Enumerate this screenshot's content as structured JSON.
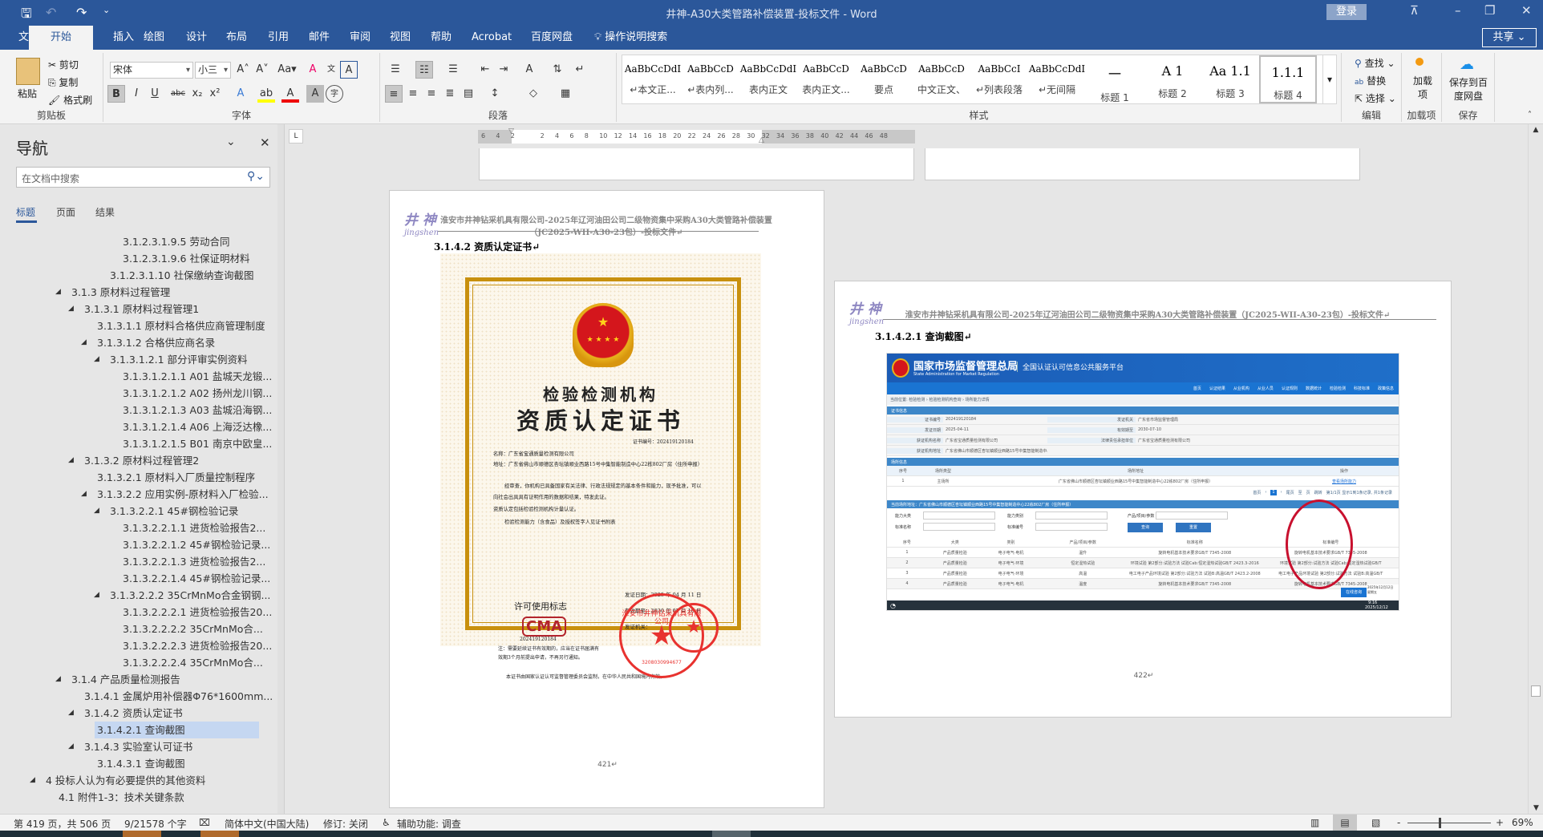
{
  "window": {
    "title": "井神-A30大类管路补偿装置-投标文件  -  Word",
    "login": "登录",
    "share": "共享"
  },
  "tabs": [
    "文件",
    "开始",
    "插入",
    "绘图",
    "设计",
    "布局",
    "引用",
    "邮件",
    "审阅",
    "视图",
    "帮助",
    "Acrobat",
    "百度网盘"
  ],
  "tell_me": "操作说明搜索",
  "ribbon": {
    "clipboard": {
      "paste": "粘贴",
      "cut": "剪切",
      "copy": "复制",
      "format_painter": "格式刷",
      "label": "剪贴板"
    },
    "font": {
      "name": "宋体",
      "size": "小三",
      "label": "字体"
    },
    "paragraph": {
      "label": "段落"
    },
    "styles": {
      "label": "样式",
      "items": [
        {
          "preview": "AaBbCcDdI",
          "name": "↵本文正..."
        },
        {
          "preview": "AaBbCcD",
          "name": "↵表内列..."
        },
        {
          "preview": "AaBbCcDdI",
          "name": "表内正文"
        },
        {
          "preview": "AaBbCcD",
          "name": "表内正文..."
        },
        {
          "preview": "AaBbCcD",
          "name": "要点"
        },
        {
          "preview": "AaBbCcD",
          "name": "中文正文、"
        },
        {
          "preview": "AaBbCcI",
          "name": "↵列表段落"
        },
        {
          "preview": "AaBbCcDdI",
          "name": "↵无间隔"
        },
        {
          "preview": "一",
          "name": "标题 1"
        },
        {
          "preview": "A 1",
          "name": "标题 2"
        },
        {
          "preview": "Aa 1.1",
          "name": "标题 3"
        },
        {
          "preview": "1.1.1",
          "name": "标题 4"
        }
      ]
    },
    "editing": {
      "find": "查找",
      "replace": "替换",
      "select": "选择",
      "label": "编辑"
    },
    "addins": {
      "button": "加载项",
      "label": "加载项"
    },
    "save": {
      "button": "保存到百度网盘",
      "label": "保存"
    }
  },
  "nav": {
    "title": "导航",
    "search_placeholder": "在文档中搜索",
    "tabs": [
      "标题",
      "页面",
      "结果"
    ],
    "items": [
      {
        "level": 7,
        "text": "3.1.2.3.1.9.5 劳动合同",
        "tri": ""
      },
      {
        "level": 7,
        "text": "3.1.2.3.1.9.6 社保证明材料",
        "tri": ""
      },
      {
        "level": 6,
        "text": "3.1.2.3.1.10 社保缴纳查询截图",
        "tri": ""
      },
      {
        "level": 3,
        "text": "3.1.3 原材料过程管理",
        "tri": "◢"
      },
      {
        "level": 4,
        "text": "3.1.3.1 原材料过程管理1",
        "tri": "◢"
      },
      {
        "level": 5,
        "text": "3.1.3.1.1 原材料合格供应商管理制度",
        "tri": ""
      },
      {
        "level": 5,
        "text": "3.1.3.1.2 合格供应商名录",
        "tri": "◢"
      },
      {
        "level": 6,
        "text": "3.1.3.1.2.1 部分评审实例资料",
        "tri": "◢"
      },
      {
        "level": 7,
        "text": "3.1.3.1.2.1.1 A01 盐城天龙锻...",
        "tri": ""
      },
      {
        "level": 7,
        "text": "3.1.3.1.2.1.2 A02 扬州龙川钢...",
        "tri": ""
      },
      {
        "level": 7,
        "text": "3.1.3.1.2.1.3 A03 盐城沿海钢...",
        "tri": ""
      },
      {
        "level": 7,
        "text": "3.1.3.1.2.1.4 A06 上海泛达橡...",
        "tri": ""
      },
      {
        "level": 7,
        "text": "3.1.3.1.2.1.5 B01 南京中欧皇...",
        "tri": ""
      },
      {
        "level": 4,
        "text": "3.1.3.2 原材料过程管理2",
        "tri": "◢"
      },
      {
        "level": 5,
        "text": "3.1.3.2.1 原材料入厂质量控制程序",
        "tri": ""
      },
      {
        "level": 5,
        "text": "3.1.3.2.2 应用实例-原材料入厂检验...",
        "tri": "◢"
      },
      {
        "level": 6,
        "text": "3.1.3.2.2.1 45#钢检验记录",
        "tri": "◢"
      },
      {
        "level": 7,
        "text": "3.1.3.2.2.1.1  进货检验报告2...",
        "tri": ""
      },
      {
        "level": 7,
        "text": "3.1.3.2.2.1.2  45#钢检验记录...",
        "tri": ""
      },
      {
        "level": 7,
        "text": "3.1.3.2.2.1.3  进货检验报告2...",
        "tri": ""
      },
      {
        "level": 7,
        "text": "3.1.3.2.2.1.4  45#钢检验记录...",
        "tri": ""
      },
      {
        "level": 6,
        "text": "3.1.3.2.2.2 35CrMnMo合金钢钢...",
        "tri": "◢"
      },
      {
        "level": 7,
        "text": "3.1.3.2.2.2.1 进货检验报告20...",
        "tri": ""
      },
      {
        "level": 7,
        "text": "3.1.3.2.2.2.2 35CrMnMo合...",
        "tri": ""
      },
      {
        "level": 7,
        "text": "3.1.3.2.2.2.3 进货检验报告20...",
        "tri": ""
      },
      {
        "level": 7,
        "text": "3.1.3.2.2.2.4 35CrMnMo合...",
        "tri": ""
      },
      {
        "level": 3,
        "text": "3.1.4 产品质量检测报告",
        "tri": "◢"
      },
      {
        "level": 4,
        "text": "3.1.4.1 金属炉用补偿器Φ76*1600mm...",
        "tri": ""
      },
      {
        "level": 4,
        "text": "3.1.4.2 资质认定证书",
        "tri": "◢"
      },
      {
        "level": 5,
        "text": "3.1.4.2.1 查询截图",
        "tri": "",
        "selected": true
      },
      {
        "level": 4,
        "text": "3.1.4.3 实验室认可证书",
        "tri": "◢"
      },
      {
        "level": 5,
        "text": "3.1.4.3.1 查询截图",
        "tri": ""
      },
      {
        "level": 1,
        "text": "4 投标人认为有必要提供的其他资料",
        "tri": "◢"
      },
      {
        "level": 2,
        "text": "4.1 附件1-3：技术关键条款",
        "tri": ""
      }
    ]
  },
  "ruler": [
    "6",
    "4",
    "2",
    "",
    "2",
    "4",
    "6",
    "8",
    "10",
    "12",
    "14",
    "16",
    "18",
    "20",
    "22",
    "24",
    "26",
    "28",
    "30",
    "32",
    "34",
    "36",
    "38",
    "40",
    "42",
    "44",
    "46",
    "48"
  ],
  "page421": {
    "header_line1": "淮安市井神钻采机具有限公司-2025年辽河油田公司二级物资集中采购A30大类管路补偿装置",
    "header_line2": "（JC2025-WII-A30-23包）-投标文件↵",
    "logo": "井神",
    "logo_sub": "jingshen",
    "heading": "3.1.4.2 资质认定证书↵",
    "cert": {
      "title1": "检验检测机构",
      "title2": "资质认定证书",
      "number": "证书编号：202419120184",
      "name": "名称：广东省宝通质量检测有限公司",
      "address": "地址：广东省佛山市顺德区杏坛镇顺业西路15号中集智能制造中心22栋802厂房（住所申报）",
      "body1": "经审查，你机构已具备国家有关法律、行政法规规定的基本条件和能力，现予批准，可以向社会出具具有证明作用的数据和结果，特发此证。",
      "body2": "资质认定包括检验检测机构计量认证。",
      "body3": "检验检测能力（含食品）及授权签字人见证书附表",
      "mark_title": "许可使用标志",
      "mark": "CMA",
      "mark_no": "202419120184",
      "issue_date": "发证日期：2025 年 04 月 11 日",
      "valid": "有效期至：2030 年 07 月 10 日",
      "issuer": "发证机关：",
      "note": "注：需要延续证书有效期的，应当在证书届满有效期3个月前提出申请，不再另行通知。",
      "footer": "本证书由国家认证认可监督管理委员会监制，在中华人民共和国境内有效。"
    },
    "stamp_text": "淮安市井神钻采机具有限公司",
    "stamp_no": "3208030994677",
    "page_number": "421↵"
  },
  "page422": {
    "header": "淮安市井神钻采机具有限公司-2025年辽河油田公司二级物资集中采购A30大类管路补偿装置（JC2025-WII-A30-23包）-投标文件↵",
    "heading": "3.1.4.2.1 查询截图↵",
    "page_number": "422↵",
    "shot": {
      "agency": "国家市场监督管理总局",
      "agency_en": "State Administration for Market Regulation",
      "platform": "全国认证认可信息公共服务平台",
      "menu": [
        "首页",
        "认证结果",
        "从业机构",
        "从业人员",
        "认证规则",
        "数据统计",
        "检验检测",
        "科技标准",
        "政策信息"
      ],
      "breadcrumb": "当前位置: 检验检测 › 检验检测机构查询 › 场所能力详情",
      "section1": "证书信息",
      "info": [
        [
          "证书编号",
          "202419120184",
          "发证机关",
          "广东省市场监督管理局"
        ],
        [
          "发证日期",
          "2025-04-11",
          "有效期至",
          "2030-07-10"
        ],
        [
          "获证机构名称",
          "广东省宝通质量检测有限公司",
          "法律责任承担单位",
          "广东省宝通质量检测有限公司"
        ],
        [
          "获证机构地址",
          "广东省佛山市顺德区杏坛镇顺业西路15号中集智能制造中心22栋802厂房（住所申报）",
          "",
          ""
        ]
      ],
      "section2": "场所信息",
      "site_headers": [
        "序号",
        "场所类型",
        "场所地址",
        "操作"
      ],
      "site_row": [
        "1",
        "主场所",
        "广东省佛山市顺德区杏坛镇顺业西路15号中集智能制造中心22栋802厂房（住所申报）",
        "查看场所能力"
      ],
      "pager": [
        "首页",
        "‹",
        "1",
        "›",
        "尾页",
        "至",
        "页",
        "跳转",
        "第1/1页 显示1到1条记录, 共1条记录"
      ],
      "section3": "当前场所地址：广东省佛山市顺德区杏坛镇顺业西路15号中集智能制造中心22栋802厂房（住所申报）",
      "filters": [
        "能力大类",
        "能力类别",
        "产品/项目/参数",
        "标准名称",
        "标准编号"
      ],
      "query": "查询",
      "reset": "重置",
      "cap_headers": [
        "序号",
        "大类",
        "类别",
        "产品/项目/参数",
        "标准名称",
        "标准编号"
      ],
      "cap_rows": [
        [
          "1",
          "产品质量检验",
          "电子电气-电机",
          "温升",
          "旋转电机基本技术要求GB/T 7345-2008",
          "旋转电机基本技术要求GB/T 7345-2008"
        ],
        [
          "2",
          "产品质量检验",
          "电子电气-环境",
          "恒定湿热试验",
          "环境试验 第2部分:试验方法 试验Cab:恒定湿热试验GB/T 2423.3-2016",
          "环境试验 第2部分:试验方法 试验Cab:恒定湿热试验GB/T"
        ],
        [
          "3",
          "产品质量检验",
          "电子电气-环境",
          "高温",
          "电工电子产品环境试验 第2部分:试验方法 试验B:高温GB/T 2423.2-2008",
          "电工电子产品环境试验 第2部分:试验方法 试验B:高温GB/T"
        ],
        [
          "4",
          "产品质量检验",
          "电子电气-电机",
          "温度",
          "旋转电机基本技术要求GB/T 7345-2008",
          "旋转电机基本技术要求GB/T 7345-2008"
        ]
      ],
      "chat": "在线咨询",
      "clock_date": "2025年12月12日",
      "clock_day": "星期五",
      "tray_time": "9:16",
      "tray_date": "2025/12/12"
    }
  },
  "status": {
    "page": "第 419 页，共 506 页",
    "words": "9/21578 个字",
    "language": "简体中文(中国大陆)",
    "track": "修订: 关闭",
    "accessibility": "辅助功能: 调查",
    "zoom": "69%"
  },
  "colors": {
    "brand": "#2b579a",
    "stamp": "#e8322f",
    "gold": "#c8900e",
    "circle": "#c8102e"
  }
}
